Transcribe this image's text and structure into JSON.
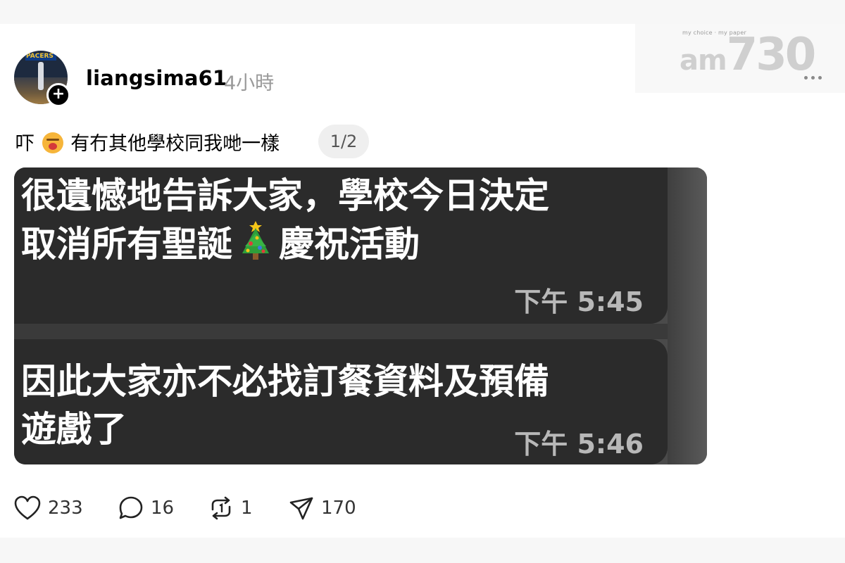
{
  "header": {
    "username": "liangsima61",
    "timestamp": "4小時",
    "avatar_text": "PACERS"
  },
  "watermark": {
    "tagline": "my choice · my paper",
    "brand_prefix": "am",
    "brand_number": "730"
  },
  "post": {
    "caption_before": "吓",
    "caption_after": "有冇其他學校同我哋一樣",
    "pager": "1/2"
  },
  "screenshot": {
    "message1": {
      "line1": "很遺憾地告訴大家，學校今日決定",
      "line2_before": "取消所有聖誕",
      "line2_after": "慶祝活動",
      "time": "下午 5:45"
    },
    "message2": {
      "line1": "因此大家亦不必找訂餐資料及預備",
      "line2": "遊戲了",
      "time": "下午 5:46"
    }
  },
  "actions": {
    "likes": "233",
    "comments": "16",
    "reposts": "1",
    "shares": "170"
  },
  "icons": {
    "like": "heart-icon",
    "comment": "comment-bubble-icon",
    "repost": "repost-icon",
    "share": "send-icon",
    "more": "more-dots-icon",
    "follow": "plus-icon",
    "emoji_caption": "anguished-face-emoji",
    "emoji_message": "christmas-tree-emoji"
  },
  "colors": {
    "bubble": "#2b2b2b",
    "muted_text": "#9a9a9a",
    "card_bg": "#ffffff",
    "page_bg": "#f7f7f7"
  }
}
